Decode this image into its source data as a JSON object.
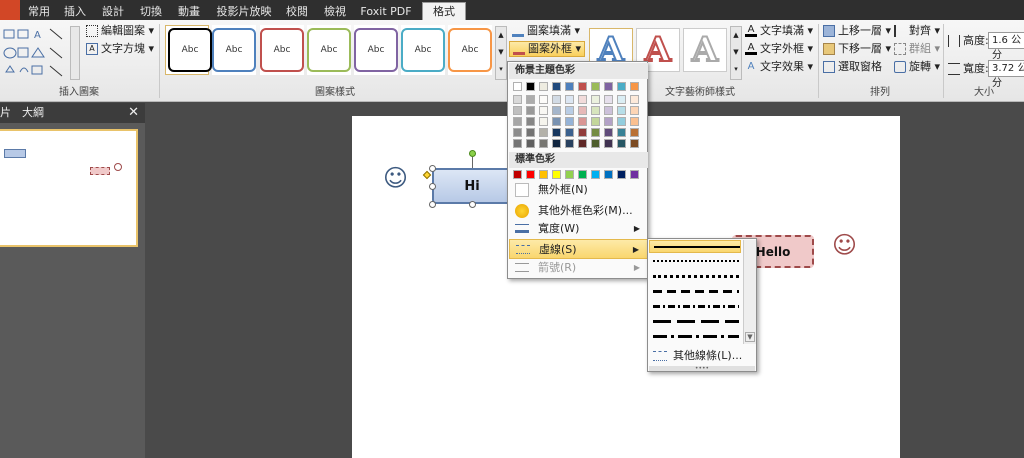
{
  "tabs": [
    "常用",
    "插入",
    "設計",
    "切換",
    "動畫",
    "投影片放映",
    "校閱",
    "檢視",
    "Foxit PDF",
    "格式"
  ],
  "ribbon": {
    "insert_shapes": {
      "edit_shape": "編輯圖案",
      "text_box": "文字方塊",
      "label": "插入圖案"
    },
    "shape_styles": {
      "style_text": "Abc",
      "label": "圖案樣式",
      "fill": "圖案填滿",
      "outline": "圖案外框"
    },
    "wordart": {
      "label": "文字藝術師樣式",
      "text_fill": "文字填滿",
      "text_outline": "文字外框",
      "text_effects": "文字效果",
      "letter": "A"
    },
    "arrange": {
      "label": "排列",
      "bring_forward": "上移一層",
      "send_backward": "下移一層",
      "selection_pane": "選取窗格",
      "align": "對齊",
      "group": "群組",
      "rotate": "旋轉"
    },
    "size": {
      "label": "大小",
      "height_label": "高度:",
      "height_value": "1.6 公分",
      "width_label": "寬度:",
      "width_value": "3.72 公分"
    }
  },
  "left_pane": {
    "tab_slides": "片",
    "tab_outline": "大綱",
    "close": "✕"
  },
  "canvas": {
    "hi_text": "Hi",
    "hello_text": "Hello",
    "smiley": "☺"
  },
  "outline_menu": {
    "theme_colors_header": "佈景主題色彩",
    "standard_colors_header": "標準色彩",
    "no_outline": "無外框(N)",
    "more_colors": "其他外框色彩(M)...",
    "weight": "寬度(W)",
    "dashes": "虛線(S)",
    "arrows": "箭號(R)"
  },
  "dash_menu": {
    "more_lines": "其他線條(L)..."
  },
  "colors": {
    "theme_top": [
      "#ffffff",
      "#000000",
      "#eeece1",
      "#1f497d",
      "#4f81bd",
      "#c0504d",
      "#9bbb59",
      "#8064a2",
      "#4bacc6",
      "#f79646"
    ],
    "standard": [
      "#c00000",
      "#ff0000",
      "#ffc000",
      "#ffff00",
      "#92d050",
      "#00b050",
      "#00b0f0",
      "#0070c0",
      "#002060",
      "#7030a0"
    ]
  }
}
